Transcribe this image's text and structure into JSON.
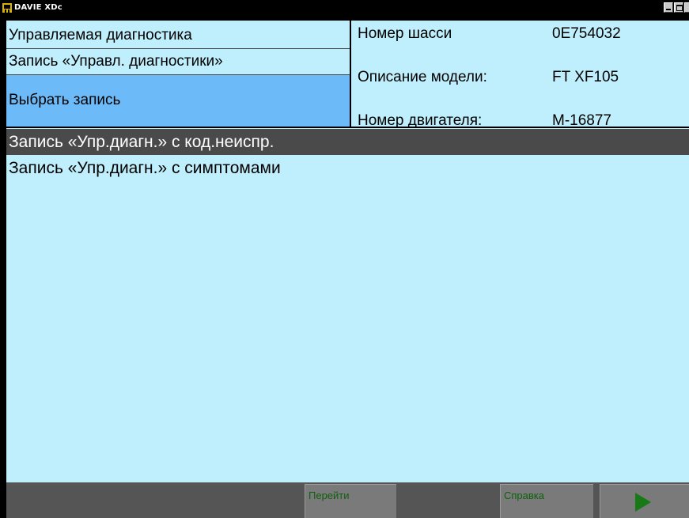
{
  "window": {
    "title": "DAVIE XDc"
  },
  "left_panel": {
    "row1": "Управляемая диагностика",
    "row2": "Запись «Управл. диагностики»",
    "row3": "Выбрать запись"
  },
  "vehicle_info": {
    "chassis_label": "Номер шасси",
    "chassis_value": "0E754032",
    "model_label": "Описание модели:",
    "model_value": "FT XF105",
    "engine_label": "Номер двигателя:",
    "engine_value": "M-16877"
  },
  "list": {
    "items": [
      "Запись «Упр.диагн.» с код.неиспр.",
      "Запись «Упр.диагн.» с симптомами"
    ],
    "selected_index": 0
  },
  "bottom_bar": {
    "goto_label": "Перейти",
    "help_label": "Справка",
    "next_icon": "play-icon"
  },
  "colors": {
    "background": "#bfeffc",
    "highlight": "#6cbaf7",
    "selected_row": "#4a4a4a",
    "button_text": "#0f5f0f",
    "play_icon": "#177a17"
  }
}
